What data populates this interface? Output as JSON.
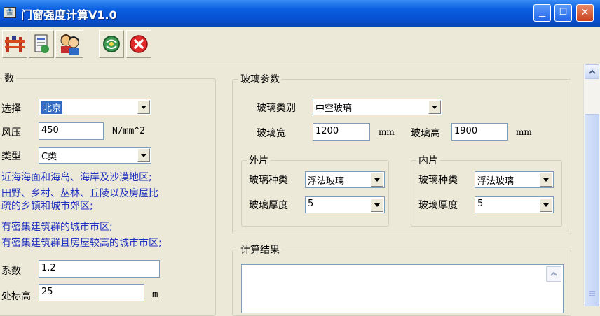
{
  "window": {
    "title": "门窗强度计算V1.0",
    "icon_glyph": "🏦",
    "minimize_glyph": "▁",
    "maximize_glyph": "☐",
    "close_glyph": "✕"
  },
  "toolbar": {
    "buttons": [
      {
        "icon": "frame-icon"
      },
      {
        "icon": "document-icon"
      },
      {
        "icon": "users-icon"
      },
      {
        "icon": "globe-refresh-icon"
      },
      {
        "icon": "exit-icon"
      }
    ]
  },
  "left_group": {
    "legend": "数",
    "city_label": "选择",
    "city_value": "北京",
    "pressure_label": "风压",
    "pressure_value": "450",
    "pressure_unit": "N/mm^2",
    "type_label": "类型",
    "type_value": "C类",
    "desc_lines": [
      "近海海面和海岛、海岸及沙漠地区;",
      "田野、乡村、丛林、丘陵以及房屋比",
      "疏的乡镇和城市郊区;",
      "有密集建筑群的城市市区;",
      "有密集建筑群且房屋较高的城市市区;"
    ],
    "coef_label": "系数",
    "coef_value": "1.2",
    "height_label": "处标高",
    "height_value": "25",
    "height_unit": "m"
  },
  "glass_group": {
    "legend": "玻璃参数",
    "type_label": "玻璃类别",
    "type_value": "中空玻璃",
    "width_label": "玻璃宽",
    "width_value": "1200",
    "width_unit": "mm",
    "height_label": "玻璃高",
    "height_value": "1900",
    "height_unit": "mm",
    "outer": {
      "legend": "外片",
      "kind_label": "玻璃种类",
      "kind_value": "浮法玻璃",
      "thick_label": "玻璃厚度",
      "thick_value": "5"
    },
    "inner": {
      "legend": "内片",
      "kind_label": "玻璃种类",
      "kind_value": "浮法玻璃",
      "thick_label": "玻璃厚度",
      "thick_value": "5"
    }
  },
  "result_group": {
    "legend": "计算结果"
  }
}
